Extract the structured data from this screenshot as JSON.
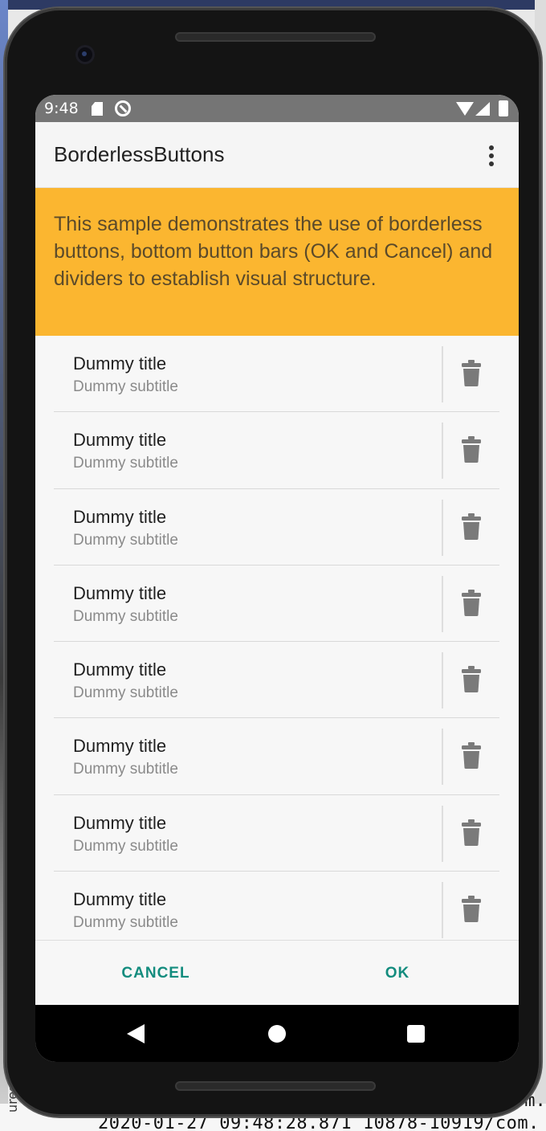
{
  "status_bar": {
    "time": "9:48",
    "icons": [
      "sd-card-icon",
      "sync-icon",
      "wifi-icon",
      "signal-icon",
      "battery-icon"
    ]
  },
  "app_bar": {
    "title": "BorderlessButtons",
    "overflow_icon": "more-vert-icon"
  },
  "banner": {
    "text": "This sample demonstrates the use of borderless buttons, bottom button bars (OK and Cancel) and dividers to establish visual structure.",
    "color": "#fbb630"
  },
  "list": {
    "items": [
      {
        "title": "Dummy title",
        "subtitle": "Dummy subtitle",
        "action_icon": "trash-icon"
      },
      {
        "title": "Dummy title",
        "subtitle": "Dummy subtitle",
        "action_icon": "trash-icon"
      },
      {
        "title": "Dummy title",
        "subtitle": "Dummy subtitle",
        "action_icon": "trash-icon"
      },
      {
        "title": "Dummy title",
        "subtitle": "Dummy subtitle",
        "action_icon": "trash-icon"
      },
      {
        "title": "Dummy title",
        "subtitle": "Dummy subtitle",
        "action_icon": "trash-icon"
      },
      {
        "title": "Dummy title",
        "subtitle": "Dummy subtitle",
        "action_icon": "trash-icon"
      },
      {
        "title": "Dummy title",
        "subtitle": "Dummy subtitle",
        "action_icon": "trash-icon"
      },
      {
        "title": "Dummy title",
        "subtitle": "Dummy subtitle",
        "action_icon": "trash-icon"
      }
    ]
  },
  "button_bar": {
    "cancel_label": "CANCEL",
    "ok_label": "OK",
    "accent": "#138c7e"
  },
  "nav_bar": {
    "icons": [
      "back-icon",
      "home-icon",
      "recents-icon"
    ]
  },
  "background": {
    "log_line": "2020-01-27 09:48:28.871 10878-10919/com.",
    "log_fragment": "om.",
    "side_label": "ures"
  }
}
